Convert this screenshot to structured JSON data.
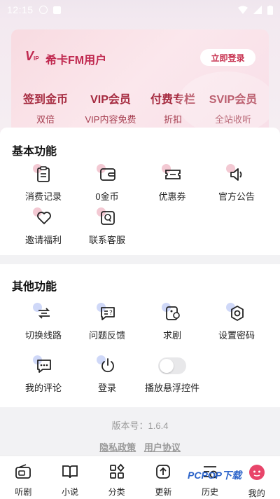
{
  "status": {
    "time": "12:15"
  },
  "vip": {
    "user_label": "希卡FM用户",
    "login_button": "立即登录",
    "perks": [
      {
        "title": "签到金币",
        "sub": "双倍"
      },
      {
        "title": "VIP会员",
        "sub": "VIP内容免费"
      },
      {
        "title": "付费专栏",
        "sub": "折扣"
      },
      {
        "title": "SVIP会员",
        "sub": "全站收听"
      }
    ]
  },
  "basic": {
    "title": "基本功能",
    "items": [
      {
        "label": "消费记录",
        "icon": "clipboard-icon"
      },
      {
        "label": "0金币",
        "icon": "wallet-icon"
      },
      {
        "label": "优惠券",
        "icon": "coupon-icon"
      },
      {
        "label": "官方公告",
        "icon": "speaker-icon"
      },
      {
        "label": "邀请福利",
        "icon": "heart-icon"
      },
      {
        "label": "联系客服",
        "icon": "service-icon"
      }
    ]
  },
  "other": {
    "title": "其他功能",
    "items": [
      {
        "label": "切换线路",
        "icon": "switch-icon"
      },
      {
        "label": "问题反馈",
        "icon": "feedback-icon"
      },
      {
        "label": "求剧",
        "icon": "request-icon"
      },
      {
        "label": "设置密码",
        "icon": "gear-icon"
      },
      {
        "label": "我的评论",
        "icon": "comment-icon"
      },
      {
        "label": "登录",
        "icon": "power-icon"
      },
      {
        "label": "播放悬浮控件",
        "icon": "toggle-icon"
      }
    ]
  },
  "footer": {
    "version": "版本号：1.6.4",
    "privacy": "隐私政策",
    "agreement": "用户协议"
  },
  "nav": [
    {
      "label": "听剧",
      "icon": "radio-icon"
    },
    {
      "label": "小说",
      "icon": "book-icon"
    },
    {
      "label": "分类",
      "icon": "category-icon"
    },
    {
      "label": "更新",
      "icon": "update-icon"
    },
    {
      "label": "历史",
      "icon": "history-icon"
    },
    {
      "label": "我的",
      "icon": "profile-icon"
    }
  ],
  "watermark": "PCPOP下载"
}
